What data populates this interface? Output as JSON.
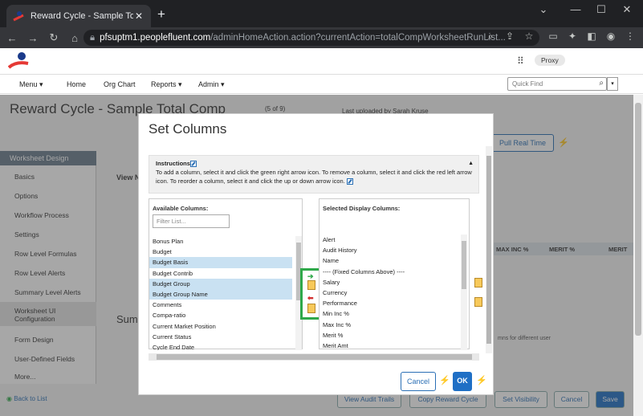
{
  "browser": {
    "tab_title": "Reward Cycle - Sample Total Com",
    "url_domain": "pfsuptm1.peoplefluent.com",
    "url_path": "/adminHomeAction.action?currentAction=totalCompWorksheetRunList..."
  },
  "header": {
    "proxy_label": "Proxy"
  },
  "nav": {
    "menu": "Menu ▾",
    "home": "Home",
    "org_chart": "Org Chart",
    "reports": "Reports ▾",
    "admin": "Admin ▾",
    "quick_find_placeholder": "Quick Find"
  },
  "page": {
    "title": "Reward Cycle - Sample Total Comp",
    "pager": "(5 of 9)",
    "last_uploaded": "Last uploaded by Sarah Kruse",
    "pull_real_time": "Pull Real Time",
    "view_label": "View N",
    "summary_label": "Summ",
    "roles_text": "mns for different user",
    "columns": [
      "MAX INC %",
      "MERIT %",
      "MERIT"
    ],
    "sidebar_header": "Worksheet Design",
    "sidebar": [
      "Basics",
      "Options",
      "Workflow Process",
      "Settings",
      "Row Level Formulas",
      "Row Level Alerts",
      "Summary Level Alerts",
      "Worksheet UI Configuration",
      "Form Design",
      "User-Defined Fields",
      "More..."
    ],
    "back_to_list": "Back to List",
    "bottom_buttons": [
      "View Audit Trails",
      "Copy Reward Cycle",
      "Set Visibility",
      "Cancel",
      "Save"
    ]
  },
  "modal": {
    "title": "Set Columns",
    "instructions_label": "Instructions",
    "instructions_text": "To add a column, select it and click the green right arrow icon. To remove a column, select it and click the red left arrow icon. To reorder a column, select it and click the up or down arrow icon.",
    "available_label": "Available Columns:",
    "filter_placeholder": "Filter List...",
    "available": [
      {
        "label": "Bonus Plan",
        "selected": false
      },
      {
        "label": "Budget",
        "selected": false
      },
      {
        "label": "Budget Basis",
        "selected": true
      },
      {
        "label": "Budget Contrib",
        "selected": false
      },
      {
        "label": "Budget Group",
        "selected": true
      },
      {
        "label": "Budget Group Name",
        "selected": true
      },
      {
        "label": "Comments",
        "selected": false
      },
      {
        "label": "Compa-ratio",
        "selected": false
      },
      {
        "label": "Current Market Position",
        "selected": false
      },
      {
        "label": "Current Status",
        "selected": false
      },
      {
        "label": "Cycle End Date",
        "selected": false
      }
    ],
    "selected_label": "Selected Display Columns:",
    "selected": [
      "Alert",
      "Audit History",
      "Name",
      "---- (Fixed Columns Above) ----",
      "Salary",
      "Currency",
      "Performance",
      "Min Inc %",
      "Max Inc %",
      "Merit %",
      "Merit Amt"
    ],
    "cancel": "Cancel",
    "ok": "OK"
  },
  "colors": {
    "accent": "#1f6fc5",
    "highlight": "#2ea84a",
    "selection": "#c9e1f2"
  }
}
